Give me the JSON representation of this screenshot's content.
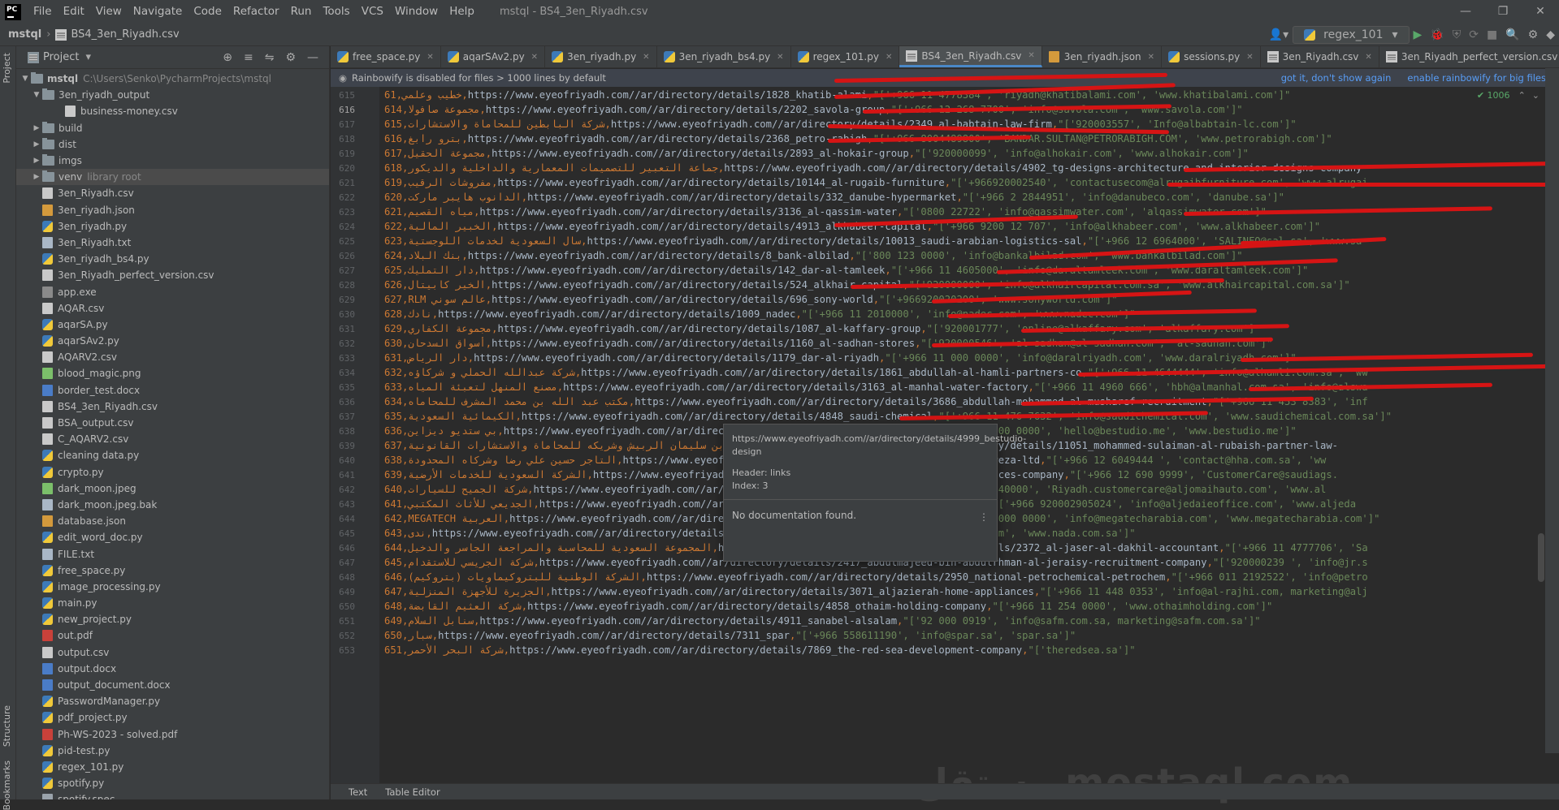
{
  "app": {
    "logo": "PC",
    "menu": [
      "File",
      "Edit",
      "View",
      "Navigate",
      "Code",
      "Refactor",
      "Run",
      "Tools",
      "VCS",
      "Window",
      "Help"
    ],
    "window_title": "mstql - BS4_3en_Riyadh.csv"
  },
  "breadcrumb": {
    "project": "mstql",
    "file": "BS4_3en_Riyadh.csv"
  },
  "run_config": {
    "label": "regex_101"
  },
  "left_strip": {
    "project": "Project",
    "structure": "Structure",
    "bookmarks": "Bookmarks"
  },
  "project_panel": {
    "title": "Project",
    "root_name": "mstql",
    "root_path": "C:\\Users\\Senko\\PycharmProjects\\mstql",
    "tree": [
      {
        "label": "3en_riyadh_output",
        "type": "folder",
        "depth": 1,
        "open": true
      },
      {
        "label": "business-money.csv",
        "type": "csv",
        "depth": 2
      },
      {
        "label": "build",
        "type": "folder",
        "depth": 1,
        "open": false
      },
      {
        "label": "dist",
        "type": "folder",
        "depth": 1,
        "open": false
      },
      {
        "label": "imgs",
        "type": "folder",
        "depth": 1,
        "open": false
      },
      {
        "label": "venv",
        "type": "folder",
        "depth": 1,
        "open": false,
        "note": "library root",
        "selected": true
      },
      {
        "label": "3en_Riyadh.csv",
        "type": "csv",
        "depth": 1
      },
      {
        "label": "3en_riyadh.json",
        "type": "json",
        "depth": 1
      },
      {
        "label": "3en_riyadh.py",
        "type": "py",
        "depth": 1
      },
      {
        "label": "3en_Riyadh.txt",
        "type": "txt",
        "depth": 1
      },
      {
        "label": "3en_riyadh_bs4.py",
        "type": "py",
        "depth": 1
      },
      {
        "label": "3en_Riyadh_perfect_version.csv",
        "type": "csv",
        "depth": 1
      },
      {
        "label": "app.exe",
        "type": "exe",
        "depth": 1
      },
      {
        "label": "AQAR.csv",
        "type": "csv",
        "depth": 1
      },
      {
        "label": "aqarSA.py",
        "type": "py",
        "depth": 1
      },
      {
        "label": "aqarSAv2.py",
        "type": "py",
        "depth": 1
      },
      {
        "label": "AQARV2.csv",
        "type": "csv",
        "depth": 1
      },
      {
        "label": "blood_magic.png",
        "type": "img",
        "depth": 1
      },
      {
        "label": "border_test.docx",
        "type": "doc",
        "depth": 1
      },
      {
        "label": "BS4_3en_Riyadh.csv",
        "type": "csv",
        "depth": 1
      },
      {
        "label": "BSA_output.csv",
        "type": "csv",
        "depth": 1
      },
      {
        "label": "C_AQARV2.csv",
        "type": "csv",
        "depth": 1
      },
      {
        "label": "cleaning data.py",
        "type": "py",
        "depth": 1
      },
      {
        "label": "crypto.py",
        "type": "py",
        "depth": 1
      },
      {
        "label": "dark_moon.jpeg",
        "type": "img",
        "depth": 1
      },
      {
        "label": "dark_moon.jpeg.bak",
        "type": "txt",
        "depth": 1
      },
      {
        "label": "database.json",
        "type": "json",
        "depth": 1
      },
      {
        "label": "edit_word_doc.py",
        "type": "py",
        "depth": 1
      },
      {
        "label": "FILE.txt",
        "type": "txt",
        "depth": 1
      },
      {
        "label": "free_space.py",
        "type": "py",
        "depth": 1
      },
      {
        "label": "image_processing.py",
        "type": "py",
        "depth": 1
      },
      {
        "label": "main.py",
        "type": "py",
        "depth": 1
      },
      {
        "label": "new_project.py",
        "type": "py",
        "depth": 1
      },
      {
        "label": "out.pdf",
        "type": "pdf",
        "depth": 1
      },
      {
        "label": "output.csv",
        "type": "csv",
        "depth": 1
      },
      {
        "label": "output.docx",
        "type": "doc",
        "depth": 1
      },
      {
        "label": "output_document.docx",
        "type": "doc",
        "depth": 1
      },
      {
        "label": "PasswordManager.py",
        "type": "py",
        "depth": 1
      },
      {
        "label": "pdf_project.py",
        "type": "py",
        "depth": 1
      },
      {
        "label": "Ph-WS-2023 - solved.pdf",
        "type": "pdf",
        "depth": 1
      },
      {
        "label": "pid-test.py",
        "type": "py",
        "depth": 1
      },
      {
        "label": "regex_101.py",
        "type": "py",
        "depth": 1
      },
      {
        "label": "spotify.py",
        "type": "py",
        "depth": 1
      },
      {
        "label": "spotify.spec",
        "type": "spec",
        "depth": 1
      }
    ]
  },
  "tabs": [
    {
      "label": "free_space.py",
      "type": "py"
    },
    {
      "label": "aqarSAv2.py",
      "type": "py"
    },
    {
      "label": "3en_riyadh.py",
      "type": "py"
    },
    {
      "label": "3en_riyadh_bs4.py",
      "type": "py"
    },
    {
      "label": "regex_101.py",
      "type": "py"
    },
    {
      "label": "BS4_3en_Riyadh.csv",
      "type": "csv",
      "active": true
    },
    {
      "label": "3en_riyadh.json",
      "type": "json"
    },
    {
      "label": "sessions.py",
      "type": "py"
    },
    {
      "label": "3en_Riyadh.csv",
      "type": "csv"
    },
    {
      "label": "3en_Riyadh_perfect_version.csv",
      "type": "csv"
    }
  ],
  "banner": {
    "text": "Rainbowify is disabled for files > 1000 lines by default",
    "link1": "got it, don't show again",
    "link2": "enable rainbowify for big files"
  },
  "inspection": "✔ 1006",
  "code_lines": [
    {
      "n": "615",
      "idx": "61",
      "ar": "خطيب وعلمي",
      "url": "https://www.eyeofriyadh.com//ar/directory/details/1828_khatib-alami",
      "rest": "\"['+966 11 4778384', 'riyadh@khatibalami.com', 'www.khatibalami.com']\""
    },
    {
      "n": "616",
      "idx": "614",
      "ar": "مجموعة صافولا",
      "url": "https://www.eyeofriyadh.com//ar/directory/details/2202_savola-group",
      "rest": "\"['+966-12-268-7700', 'info@savola.com', 'www.savola.com']\""
    },
    {
      "n": "617",
      "idx": "615",
      "ar": "شركة البابطين للمحاماة والاستشارات",
      "url": "https://www.eyeofriyadh.com//ar/directory/details/2349_al-babtain-law-firm",
      "rest": "\"['920003557', 'Info@albabtain-lc.com']\""
    },
    {
      "n": "618",
      "idx": "616",
      "ar": "بترو رابغ",
      "url": "https://www.eyeofriyadh.com//ar/directory/details/2368_petro-rabigh",
      "rest": "\"['+966 8004489800', 'BANDAR.SULTAN@PETRORABIGH.COM', 'www.petrorabigh.com']\""
    },
    {
      "n": "619",
      "idx": "617",
      "ar": "مجموعة الحقيل",
      "url": "https://www.eyeofriyadh.com//ar/directory/details/2893_al-hokair-group",
      "rest": "\"['920000099', 'info@alhokair.com', 'www.alhokair.com']\""
    },
    {
      "n": "620",
      "idx": "618",
      "ar": "جماعة التعبير للتصميمات المعمارية والداخلية والديكور",
      "url": "https://www.eyeofriyadh.com//ar/directory/details/4902_tg-designs-architecture-and-interior-designs-company",
      "rest": ""
    },
    {
      "n": "621",
      "idx": "619",
      "ar": "مفروشات الرقيب",
      "url": "https://www.eyeofriyadh.com//ar/directory/details/10144_al-rugaib-furniture",
      "rest": "\"['+966920002540', 'contactusecom@alrugaibfurniture.com', 'www.alrugai"
    },
    {
      "n": "622",
      "idx": "620",
      "ar": "الدانوب هايبر ماركت",
      "url": "https://www.eyeofriyadh.com//ar/directory/details/332_danube-hypermarket",
      "rest": "\"['+966 2 2844951', 'info@danubeco.com', 'danube.sa']\""
    },
    {
      "n": "623",
      "idx": "621",
      "ar": "مياه القصيم",
      "url": "https://www.eyeofriyadh.com//ar/directory/details/3136_al-qassim-water",
      "rest": "\"['0800 22722', 'info@qassimwater.com', 'alqassimwater.com']\""
    },
    {
      "n": "624",
      "idx": "622",
      "ar": "الخبير المالية",
      "url": "https://www.eyeofriyadh.com//ar/directory/details/4913_alkhabeer-capital",
      "rest": "\"['+966 9200 12 707', 'info@alkhabeer.com', 'www.alkhabeer.com']\""
    },
    {
      "n": "625",
      "idx": "623",
      "ar": "سال السعودية لخدمات اللوجستية",
      "url": "https://www.eyeofriyadh.com//ar/directory/details/10013_saudi-arabian-logistics-sal",
      "rest": "\"['+966 12 6964000', 'SALINFO@sal.sa', 'www.sa"
    },
    {
      "n": "626",
      "idx": "624",
      "ar": "بنك البلاد",
      "url": "https://www.eyeofriyadh.com//ar/directory/details/8_bank-albilad",
      "rest": "\"['800 123 0000', 'info@bankalbilad.com', 'www.bankalbilad.com']\""
    },
    {
      "n": "627",
      "idx": "625",
      "ar": "دار التمليك",
      "url": "https://www.eyeofriyadh.com//ar/directory/details/142_dar-al-tamleek",
      "rest": "\"['+966 11 4605000', 'info@daraltamleek.com', 'www.daraltamleek.com']\""
    },
    {
      "n": "628",
      "idx": "626",
      "ar": "الخير كابيتال",
      "url": "https://www.eyeofriyadh.com//ar/directory/details/524_alkhair-capital",
      "rest": "\"['920000000', 'info@alkhaircapital.com.sa', 'www.alkhaircapital.com.sa']\""
    },
    {
      "n": "629",
      "idx": "627",
      "ar": "RLM عالم سوني",
      "url": "https://www.eyeofriyadh.com//ar/directory/details/696_sony-world",
      "rest": "\"['+966920020200', 'www.sonyworld.com']\""
    },
    {
      "n": "630",
      "idx": "628",
      "ar": "نادك",
      "url": "https://www.eyeofriyadh.com//ar/directory/details/1009_nadec",
      "rest": "\"['+966 11 2010000', 'info@nadec.com', 'www.nadec.com']\""
    },
    {
      "n": "631",
      "idx": "629",
      "ar": "مجموعة الكفاري",
      "url": "https://www.eyeofriyadh.com//ar/directory/details/1087_al-kaffary-group",
      "rest": "\"['920001777', 'online@alkaffary.com', 'alkaffary.com']\""
    },
    {
      "n": "632",
      "idx": "630",
      "ar": "أسواق السدحان",
      "url": "https://www.eyeofriyadh.com//ar/directory/details/1160_al-sadhan-stores",
      "rest": "\"['920000546', 'al-sadhan@al-sadhan.com', 'al-sadhan.com']\""
    },
    {
      "n": "633",
      "idx": "631",
      "ar": "دار الرياض",
      "url": "https://www.eyeofriyadh.com//ar/directory/details/1179_dar-al-riyadh",
      "rest": "\"['+966 11 000 0000', 'info@daralriyadh.com', 'www.daralriyadh.com']\""
    },
    {
      "n": "634",
      "idx": "632",
      "ar": "شركة عبدالله الحملي و شركاؤه",
      "url": "https://www.eyeofriyadh.com//ar/directory/details/1861_abdullah-al-hamli-partners-co",
      "rest": "\"['+966 11 4644444', 'info@alhamli.com.sa', 'ww"
    },
    {
      "n": "635",
      "idx": "633",
      "ar": "مصنع المنهل لتعبئة المياه",
      "url": "https://www.eyeofriyadh.com//ar/directory/details/3163_al-manhal-water-factory",
      "rest": "\"['+966 11 4960 666', 'hbh@almanhal.com.sa', 'info@alswa"
    },
    {
      "n": "636",
      "idx": "634",
      "ar": "مكتب عبد الله بن محمد المشرف للمحاماه",
      "url": "https://www.eyeofriyadh.com//ar/directory/details/3686_abdullah-mohammed-al-musharef-recruitment",
      "rest": "\"['+966 11 453 8383', 'inf"
    },
    {
      "n": "637",
      "idx": "635",
      "ar": "الكيمائية السعودية",
      "url": "https://www.eyeofriyadh.com//ar/directory/details/4848_saudi-chemical",
      "rest": "\"['+966 11 476 7632', 'info@saudichemical.com', 'www.saudichemical.com.sa']\""
    },
    {
      "n": "638",
      "idx": "636",
      "ar": "بي ستديو ديزاين",
      "url": "https://www.eyeofriyadh.com//ar/directory/details/4999_bestudio-design",
      "rest": "\"['+966 11 000 0000', 'hello@bestudio.me', 'www.bestudio.me']\""
    },
    {
      "n": "639",
      "idx": "637",
      "ar": "محمد بن سليمان الربيش وشريكه للمحاماة والاستشارات القانونية",
      "url": "https://www.eyeofriyadh.com//ar/directory/details/11051_mohammed-sulaiman-al-rubaish-partner-law-",
      "rest": ""
    },
    {
      "n": "640",
      "idx": "638",
      "ar": "التاجر حسين علي رضا وشركاه المحدودة",
      "url": "https://www.eyeofriyadh.com//ar/directory/details/hussein-ali-reza-ltd",
      "rest": "\"['+966 12 6049444 ', 'contact@hha.com.sa', 'ww"
    },
    {
      "n": "641",
      "idx": "639",
      "ar": "الشركة السعودية للخدمات الأرضية",
      "url": "https://www.eyeofriyadh.com//ar/directory/details/saudi-ground-services-company",
      "rest": "\"['+966 12 690 9999', 'CustomerCare@saudiags."
    },
    {
      "n": "642",
      "idx": "640",
      "ar": "شركة الجميح للسيارات",
      "url": "https://www.eyeofriyadh.com//ar/directory/details/aljomaih-automotive",
      "rest": "\"['8001240000', 'Riyadh.customercare@aljomaihauto.com', 'www.al"
    },
    {
      "n": "643",
      "idx": "641",
      "ar": "الجديعي للأثاث المكتبي",
      "url": "https://www.eyeofriyadh.com//ar/directory/details/aljedaie-office-furniture",
      "rest": "\"['+966 920002905024', 'info@aljedaieoffice.com', 'www.aljeda"
    },
    {
      "n": "644",
      "idx": "642",
      "ar": "MEGATECH العربية",
      "url": "https://www.eyeofriyadh.com//ar/directory/details/1848_megatech-arabia",
      "rest": "\"['+966 11 000 0000', 'info@megatecharabia.com', 'www.megatecharabia.com']\""
    },
    {
      "n": "645",
      "idx": "643",
      "ar": "ندى",
      "url": "https://www.eyeofriyadh.com//ar/directory/details/2159_nada",
      "rest": "\"['8003066666 ', 'nada@nadadairy.com', 'www.nada.com.sa']\""
    },
    {
      "n": "646",
      "idx": "644",
      "ar": "المجموعة السعودية للمحاسبة والمراجعة الجاسر والدخيل",
      "url": "https://www.eyeofriyadh.com//ar/directory/details/2372_al-jaser-al-dakhil-accountant",
      "rest": "\"['+966 11 4777706', 'Sa"
    },
    {
      "n": "647",
      "idx": "645",
      "ar": "شركة الجريسي للاستقدام",
      "url": "https://www.eyeofriyadh.com//ar/directory/details/2417_abdulmajeed-bin-abdulrhman-al-jeraisy-recruitment-company",
      "rest": "\"['920000239 ', 'info@jr.s"
    },
    {
      "n": "648",
      "idx": "646",
      "ar": "الشركة الوطنية للبتروكيماويات (بتروكيم)",
      "url": "https://www.eyeofriyadh.com//ar/directory/details/2950_national-petrochemical-petrochem",
      "rest": "\"['+966 011 2192522', 'info@petro"
    },
    {
      "n": "649",
      "idx": "647",
      "ar": "الجزيرة للأجهزة المنزلية",
      "url": "https://www.eyeofriyadh.com//ar/directory/details/3071_aljazierah-home-appliances",
      "rest": "\"['+966 11 448 0353', 'info@al-rajhi.com, marketing@alj"
    },
    {
      "n": "650",
      "idx": "648",
      "ar": "شركة العثيم القابضة",
      "url": "https://www.eyeofriyadh.com//ar/directory/details/4858_othaim-holding-company",
      "rest": "\"['+966 11 254 0000', 'www.othaimholding.com']\""
    },
    {
      "n": "651",
      "idx": "649",
      "ar": "سنابل السلام",
      "url": "https://www.eyeofriyadh.com//ar/directory/details/4911_sanabel-alsalam",
      "rest": "\"['92 000 0919', 'info@safm.com.sa, marketing@safm.com.sa']\""
    },
    {
      "n": "652",
      "idx": "650",
      "ar": "سبار",
      "url": "https://www.eyeofriyadh.com//ar/directory/details/7311_spar",
      "rest": "\"['+966 558611190', 'info@spar.sa', 'spar.sa']\""
    },
    {
      "n": "653",
      "idx": "651",
      "ar": "شركة البحر الأحمر",
      "url": "https://www.eyeofriyadh.com//ar/directory/details/7869_the-red-sea-development-company",
      "rest": "\"['theredsea.sa']\""
    }
  ],
  "popup": {
    "url": "https://www.eyeofriyadh.com//ar/directory/details/4999_bestudio-design",
    "header": "Header: links",
    "index": "Index: 3",
    "doc": "No documentation found."
  },
  "bottom_tabs": [
    "Text",
    "Table Editor"
  ],
  "watermark": "مستقل mostaql.com",
  "colors": {
    "redact": "#d61414",
    "accent": "#4a88c7",
    "link": "#589df6"
  }
}
